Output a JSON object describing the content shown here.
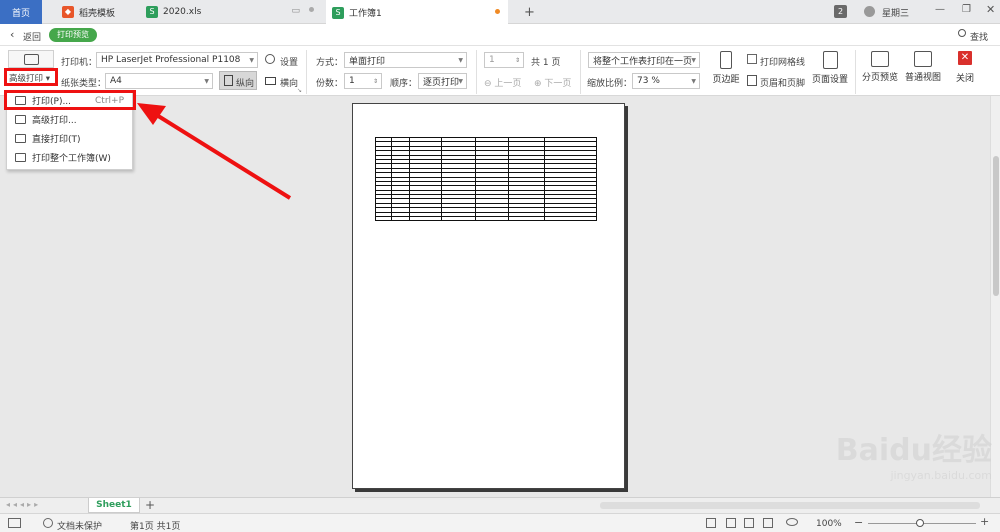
{
  "tabs": {
    "home": "首页",
    "templates": "稻壳模板",
    "file": "2020.xls",
    "workbook": "工作簿1",
    "add": "+"
  },
  "titlebar": {
    "badge": "2",
    "weekday": "星期三"
  },
  "subbar": {
    "back": "返回",
    "print_preview": "打印预览",
    "search": "查找"
  },
  "ribbon": {
    "printer_label": "打印机：",
    "printer_value": "HP LaserJet Professional P1108",
    "settings": "设置",
    "advanced_print": "高级打印",
    "paper_type_label": "纸张类型：",
    "paper_type_value": "A4",
    "portrait": "纵向",
    "landscape": "横向",
    "mode_label": "方式：",
    "mode_value": "单面打印",
    "copies_label": "份数：",
    "copies_value": "1",
    "order_label": "顺序：",
    "order_value": "逐页打印",
    "page_value": "1",
    "page_total": "共 1 页",
    "prev_page": "上一页",
    "next_page": "下一页",
    "fit_value": "将整个工作表打印在一页",
    "zoom_label": "缩放比例：",
    "zoom_value": "73 %",
    "grid_lines": "打印网格线",
    "header_footer": "页眉和页脚",
    "margins": "页边距",
    "page_setup": "页面设置",
    "page_break": "分页预览",
    "normal_view": "普通视图",
    "close": "关闭"
  },
  "menu": {
    "items": [
      {
        "label": "打印(P)...",
        "shortcut": "Ctrl+P"
      },
      {
        "label": "高级打印...",
        "shortcut": ""
      },
      {
        "label": "直接打印(T)",
        "shortcut": ""
      },
      {
        "label": "打印整个工作簿(W)",
        "shortcut": ""
      }
    ]
  },
  "sheet": {
    "tab": "Sheet1",
    "add": "+"
  },
  "status": {
    "protection": "文档未保护",
    "page_info": "第1页 共1页",
    "zoom": "100%"
  },
  "watermark": {
    "brand": "Baidu经验",
    "url": "jingyan.baidu.com"
  },
  "colors": {
    "accent": "#3b6fc4",
    "highlight": "#ee1111",
    "green_pill": "#45a74b",
    "close_red": "#d9302c"
  }
}
